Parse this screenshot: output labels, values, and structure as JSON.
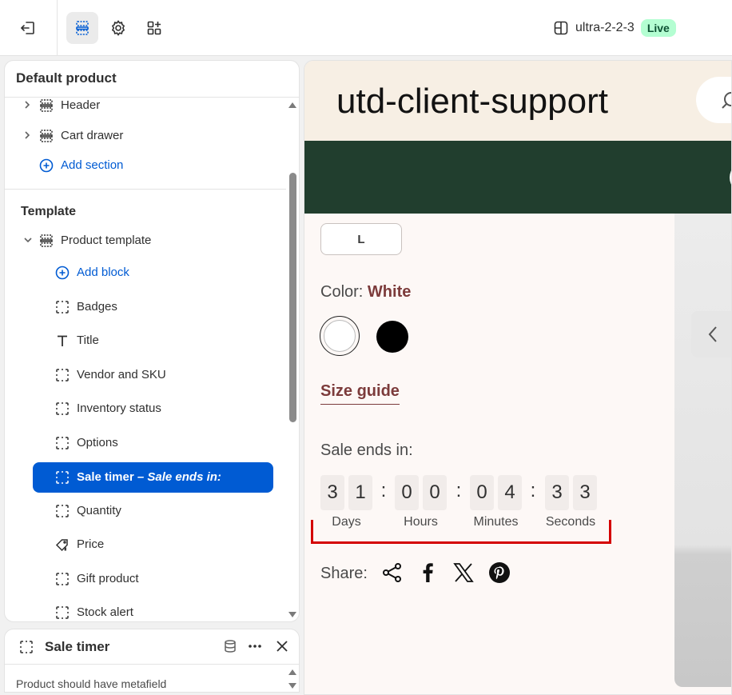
{
  "topbar": {
    "theme_name": "ultra-2-2-3",
    "status_badge": "Live"
  },
  "sidebar": {
    "title": "Default product",
    "header_sections": [
      {
        "label": "Header"
      },
      {
        "label": "Cart drawer"
      }
    ],
    "add_section_label": "Add section",
    "template_heading": "Template",
    "product_template_label": "Product template",
    "add_block_label": "Add block",
    "blocks": [
      {
        "label": "Badges",
        "icon": "block-icon"
      },
      {
        "label": "Title",
        "icon": "title-text-icon"
      },
      {
        "label": "Vendor and SKU",
        "icon": "block-icon"
      },
      {
        "label": "Inventory status",
        "icon": "block-icon"
      },
      {
        "label": "Options",
        "icon": "block-icon"
      },
      {
        "label": "Sale timer",
        "icon": "block-icon"
      },
      {
        "label": "Quantity",
        "icon": "block-icon"
      },
      {
        "label": "Price",
        "icon": "price-tag-icon"
      },
      {
        "label": "Gift product",
        "icon": "block-icon"
      },
      {
        "label": "Stock alert",
        "icon": "block-icon"
      }
    ],
    "selected_block_suffix": "– Sale ends in:"
  },
  "block_panel": {
    "title": "Sale timer",
    "description": "Product should have metafield"
  },
  "preview": {
    "store_name": "utd-client-support",
    "size_option": "L",
    "color_label": "Color:",
    "color_value": "White",
    "size_guide": "Size guide",
    "sale_label": "Sale ends in:",
    "digits": [
      "3",
      "1",
      "0",
      "0",
      "0",
      "4",
      "3",
      "3"
    ],
    "separator": ":",
    "units": [
      "Days",
      "Hours",
      "Minutes",
      "Seconds"
    ],
    "share_label": "Share:"
  },
  "colors": {
    "accent": "#005bd3",
    "live_badge_bg": "#b4fed2",
    "nav_band": "#213e2e",
    "store_header": "#f7efe4",
    "highlight": "#d40000",
    "brand_text": "#7c3b3b"
  }
}
